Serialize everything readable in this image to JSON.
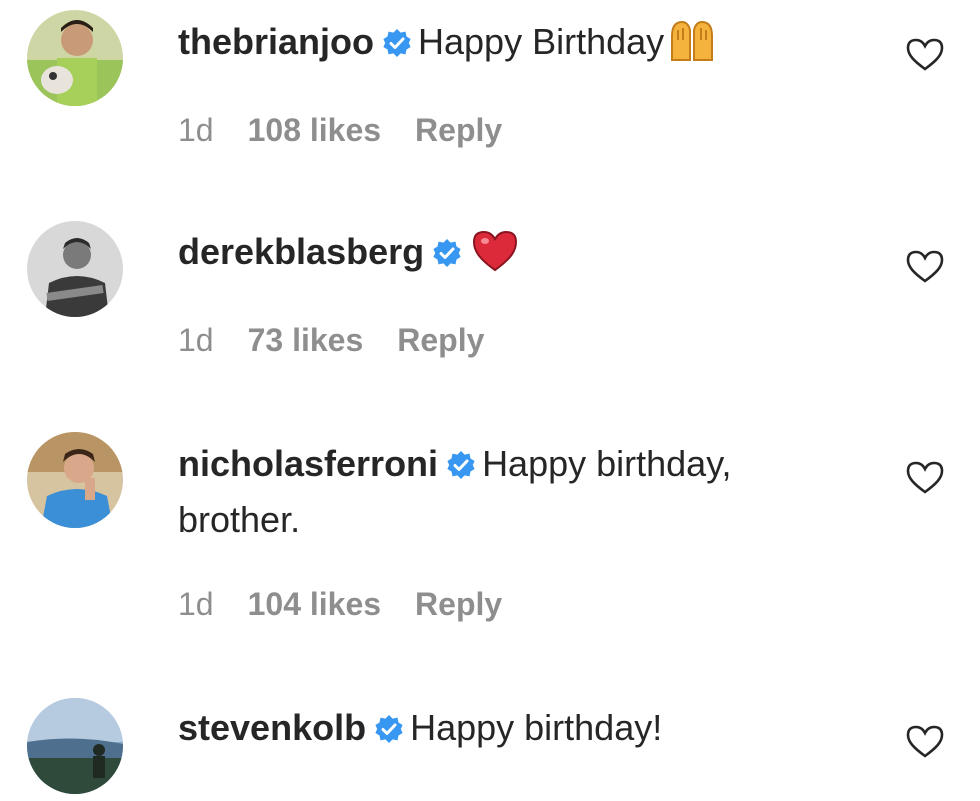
{
  "comments": [
    {
      "username": "thebrianjoo",
      "text": "Happy Birthday",
      "emoji": "raising-hands-emoji",
      "time": "1d",
      "likes": "108 likes",
      "reply": "Reply"
    },
    {
      "username": "derekblasberg",
      "text": "",
      "emoji": "red-heart-emoji",
      "time": "1d",
      "likes": "73 likes",
      "reply": "Reply"
    },
    {
      "username": "nicholasferroni",
      "text": "Happy birthday, brother.",
      "time": "1d",
      "likes": "104 likes",
      "reply": "Reply"
    },
    {
      "username": "stevenkolb",
      "text": "Happy birthday!"
    }
  ],
  "colors": {
    "verified": "#3897f0",
    "meta": "#8e8e8e",
    "text": "#262626"
  }
}
